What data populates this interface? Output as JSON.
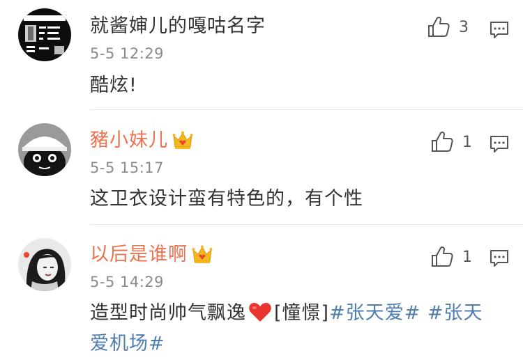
{
  "comments": [
    {
      "username": "就酱婶儿的嘎咕名字",
      "time": "5-5 12:29",
      "content": "酷炫!",
      "likes": "3",
      "vip": false
    },
    {
      "username": "豬小妹儿",
      "time": "5-5 15:17",
      "content": "这卫衣设计蛮有特色的，有个性",
      "likes": "1",
      "vip": true
    },
    {
      "username": "以后是谁啊",
      "time": "5-5 14:29",
      "content_prefix": "造型时尚帅气飘逸",
      "content_sticker": "[憧憬]",
      "content_tags": [
        "#张天爱#",
        "#张天爱机场#"
      ],
      "likes": "1",
      "vip": true
    }
  ],
  "colors": {
    "username_vip": "#eb7350",
    "username_plain": "#333333",
    "timestamp": "#8a8a8a",
    "hashtag": "#507daf",
    "crown_gold": "#f5b81f",
    "crown_red": "#e9462c"
  },
  "icons": [
    "thumbs-up-icon",
    "reply-comment-icon",
    "vip-crown-icon",
    "red-heart-emoji"
  ]
}
